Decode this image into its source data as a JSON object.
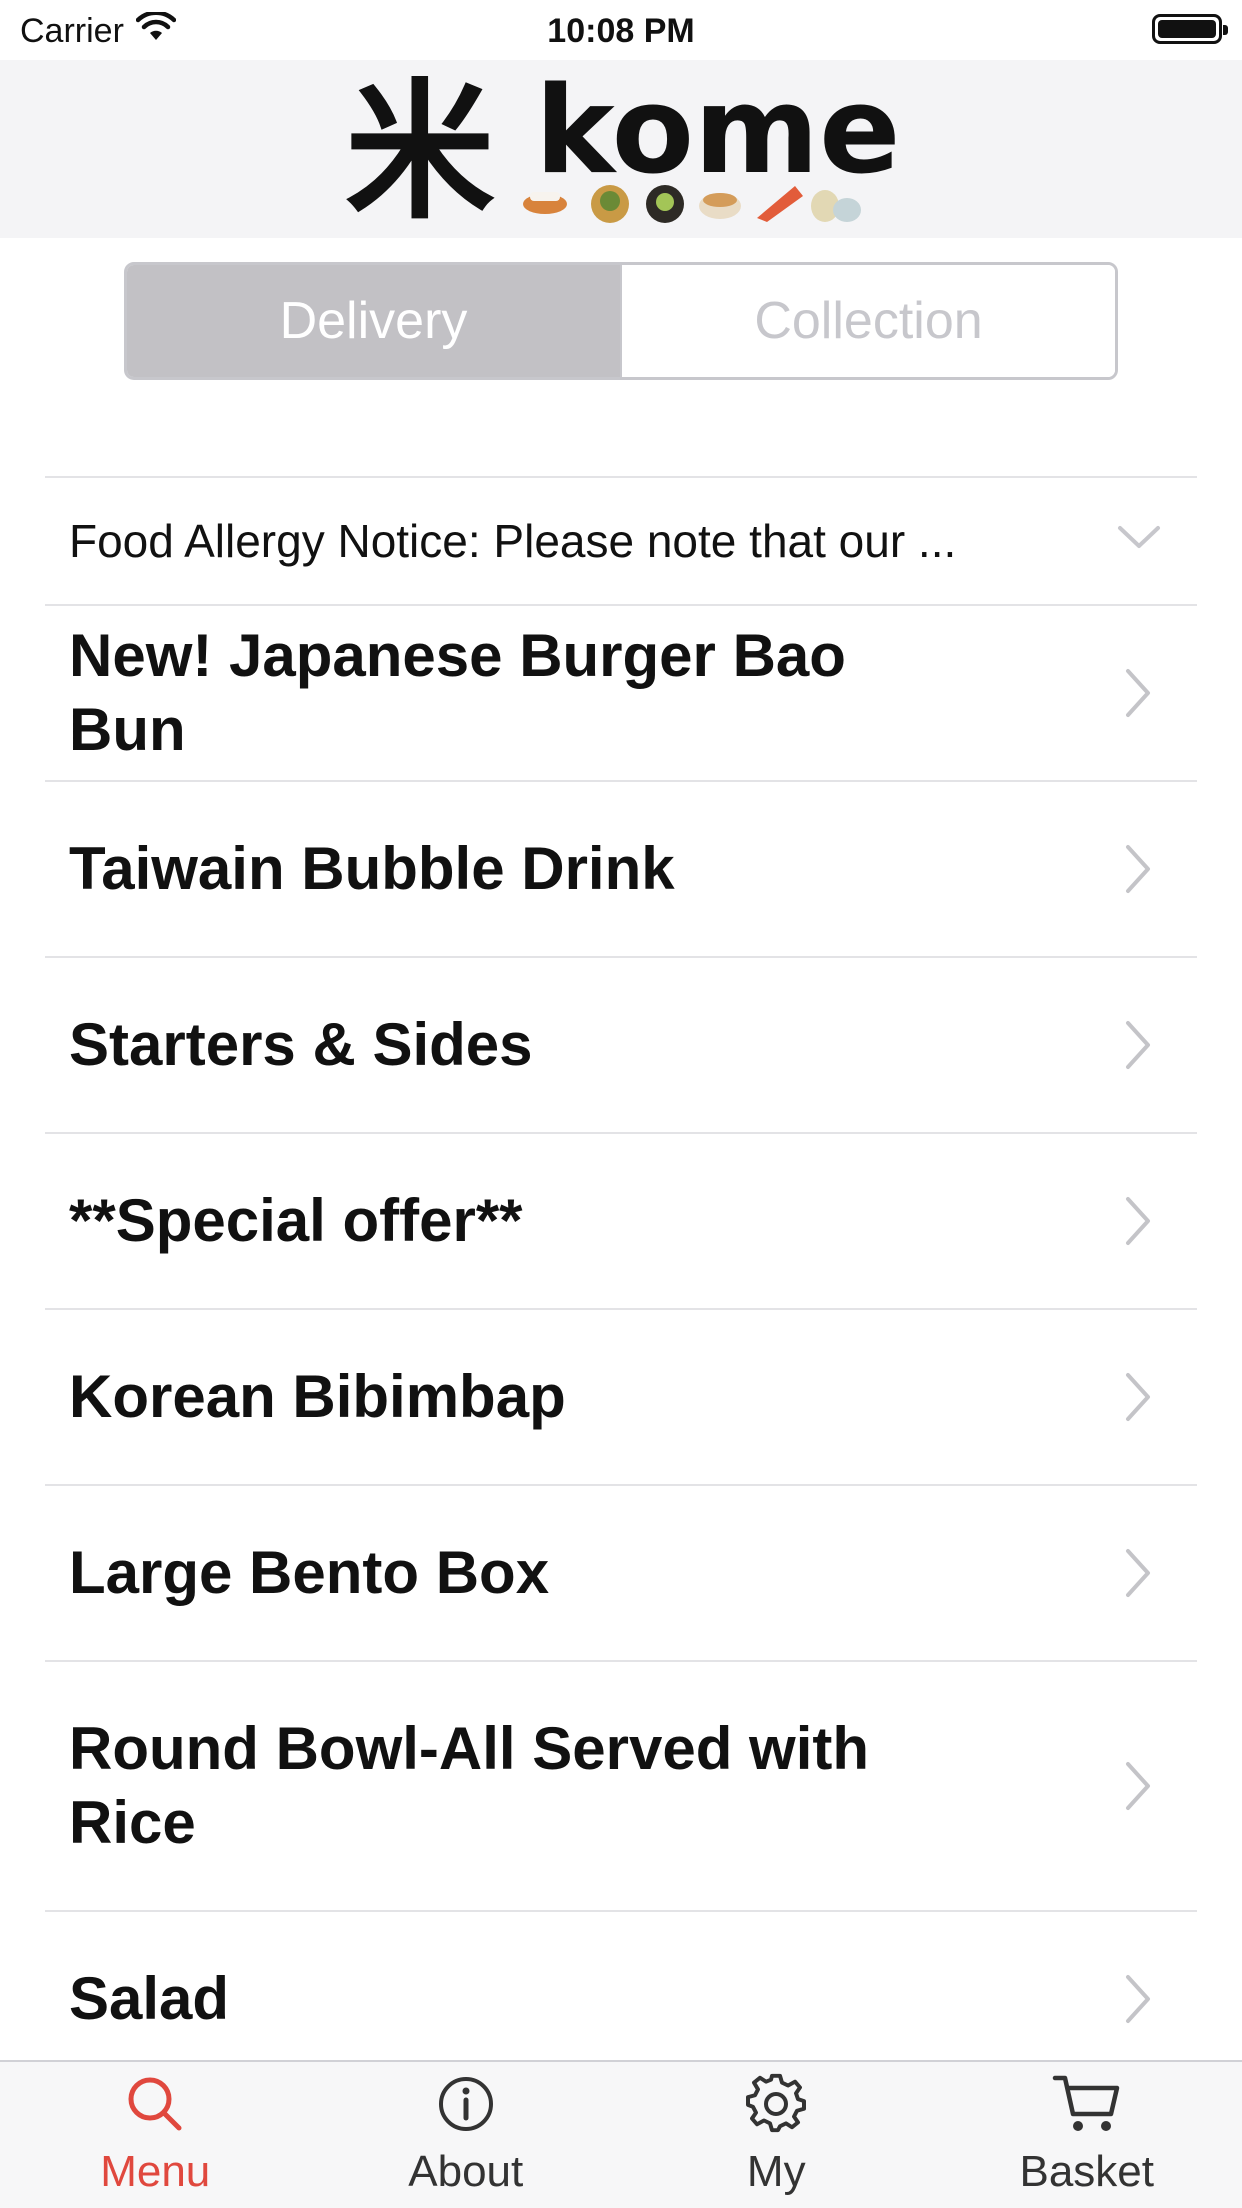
{
  "status_bar": {
    "carrier": "Carrier",
    "time": "10:08 PM"
  },
  "header": {
    "logo_kanji": "米",
    "logo_text": "kome"
  },
  "order_mode": {
    "options": [
      "Delivery",
      "Collection"
    ],
    "selected": "Delivery"
  },
  "notice": {
    "text": "Food Allergy Notice: Please note that our ..."
  },
  "categories": [
    {
      "label": "New! Japanese Burger Bao Bun"
    },
    {
      "label": "Taiwain Bubble Drink"
    },
    {
      "label": "Starters & Sides"
    },
    {
      "label": "**Special offer**"
    },
    {
      "label": "Korean Bibimbap"
    },
    {
      "label": "Large Bento Box"
    },
    {
      "label": "Round Bowl-All Served with Rice"
    },
    {
      "label": "Salad"
    }
  ],
  "tabs": [
    {
      "label": "Menu",
      "icon": "search-icon",
      "active": true
    },
    {
      "label": "About",
      "icon": "info-icon",
      "active": false
    },
    {
      "label": "My",
      "icon": "gear-icon",
      "active": false
    },
    {
      "label": "Basket",
      "icon": "cart-icon",
      "active": false
    }
  ],
  "colors": {
    "accent": "#e0483e",
    "segment_active": "#c2c1c5",
    "header_bg": "#f4f4f6"
  }
}
